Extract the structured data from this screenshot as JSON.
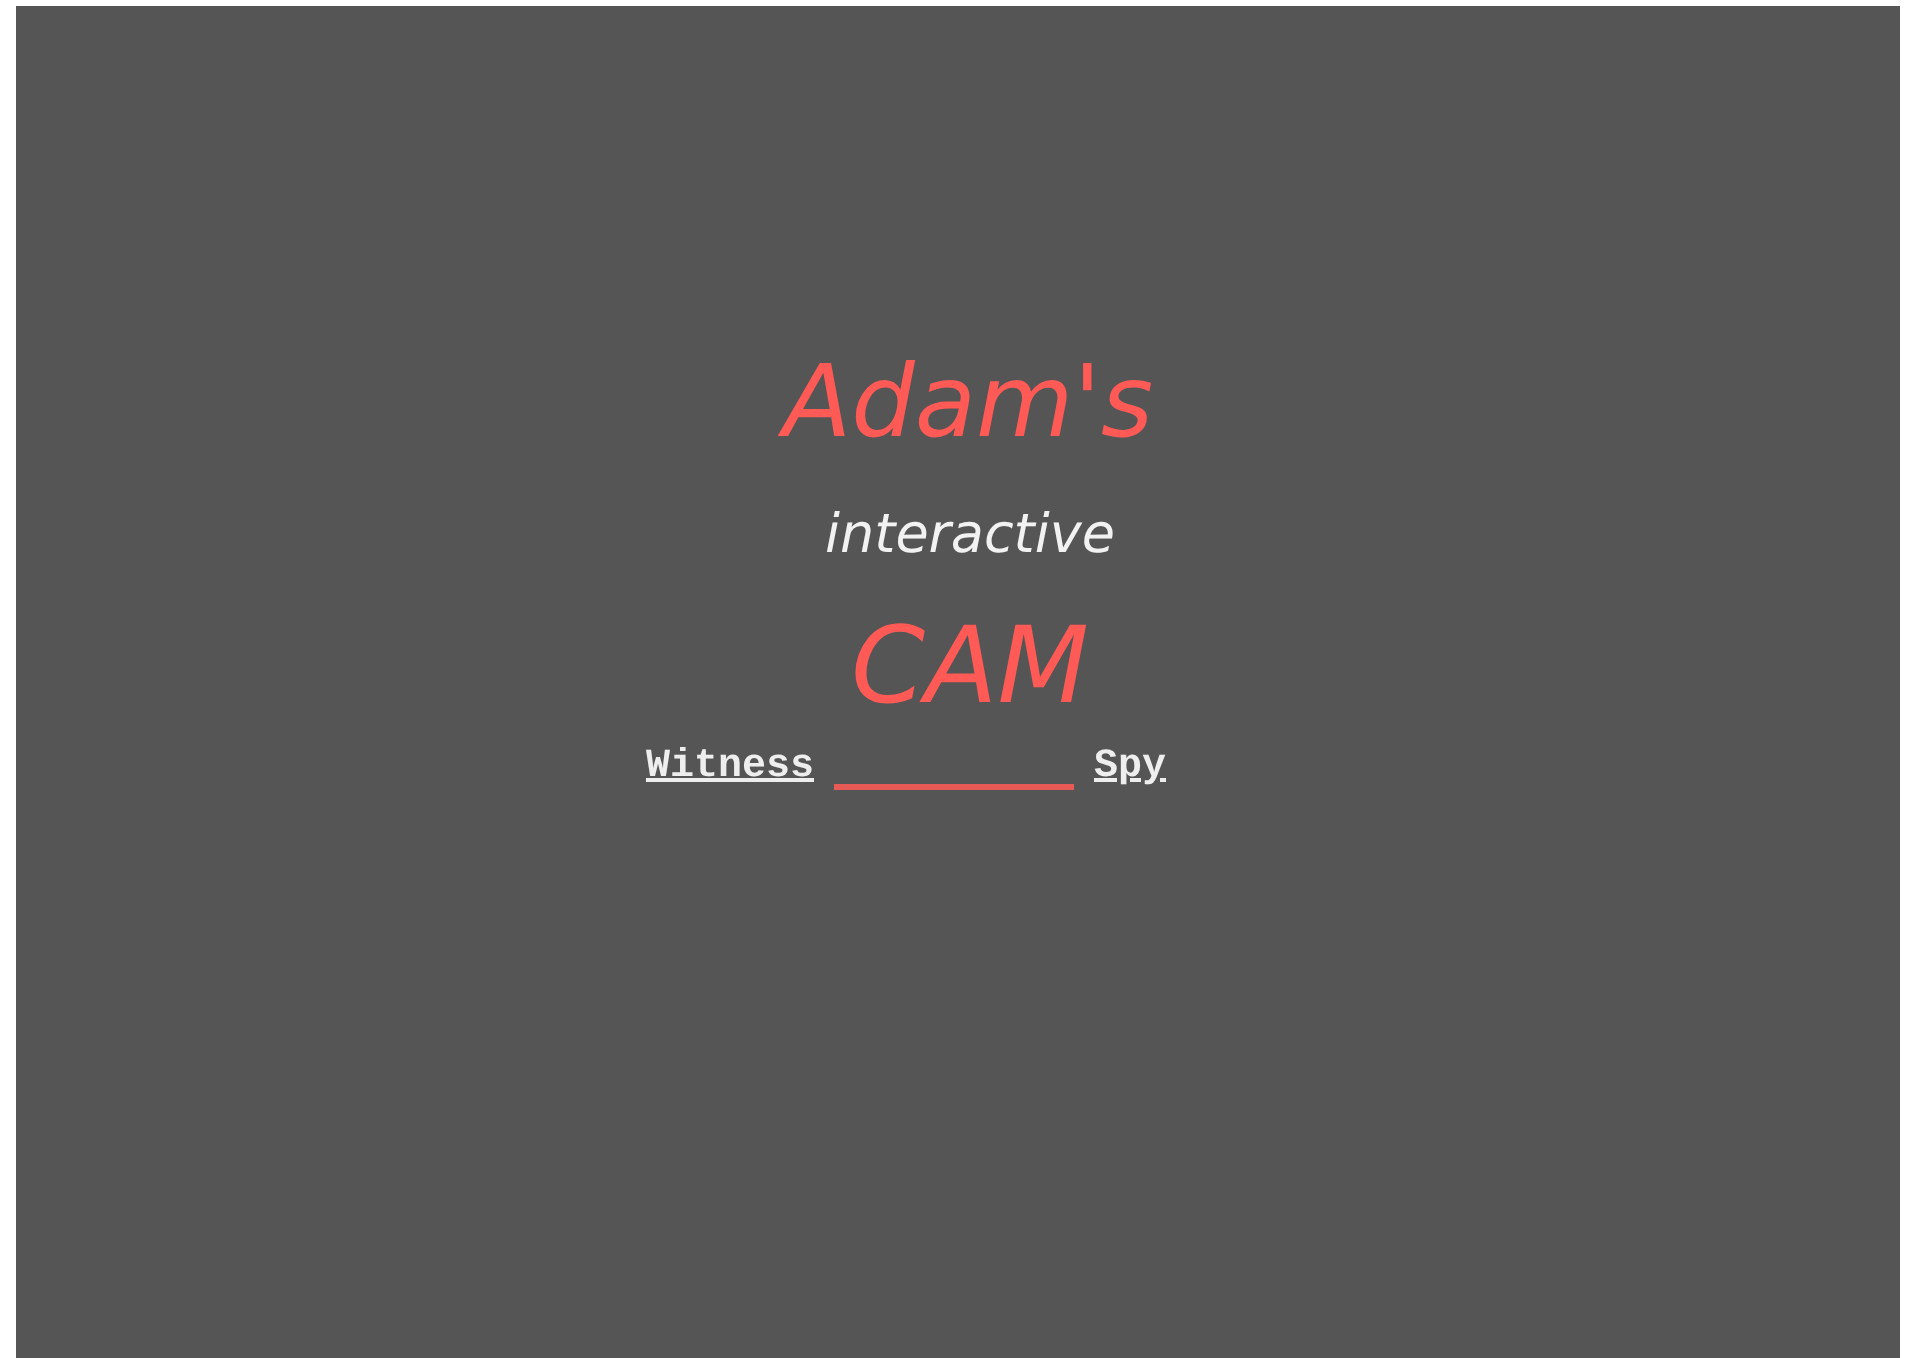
{
  "title": {
    "line_1": "Adam's",
    "line_2": "interactive",
    "line_3": "CAM"
  },
  "links": [
    {
      "label": "Witness"
    },
    {
      "kind": "blank"
    },
    {
      "label": "Spy"
    }
  ]
}
